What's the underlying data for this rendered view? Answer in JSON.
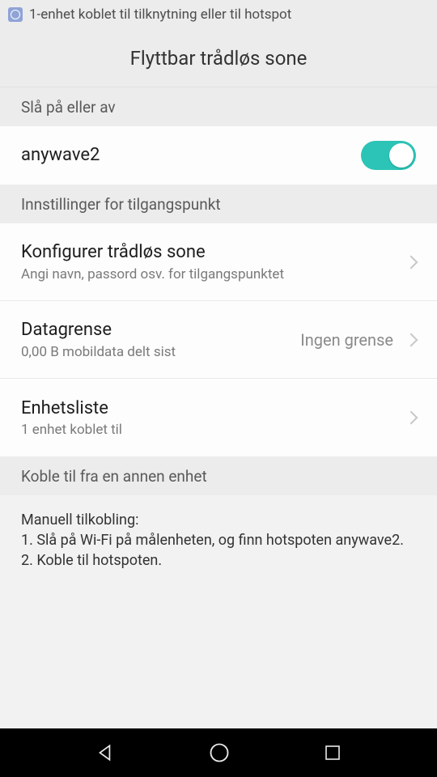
{
  "notif": {
    "text": "1-enhet koblet til tilknytning eller til hotspot"
  },
  "title": "Flyttbar trådløs sone",
  "sections": {
    "toggle_header": "Slå på eller av",
    "ap_header": "Innstillinger for tilgangspunkt",
    "connect_header": "Koble til fra en annen enhet"
  },
  "hotspot": {
    "ssid": "anywave2",
    "enabled": true
  },
  "config": {
    "title": "Konfigurer trådløs sone",
    "sub": "Angi navn, passord osv. for tilgangspunktet"
  },
  "datalimit": {
    "title": "Datagrense",
    "sub": "0,00 B mobildata delt sist",
    "value": "Ingen grense"
  },
  "devices": {
    "title": "Enhetsliste",
    "sub": "1 enhet koblet til"
  },
  "instructions": {
    "heading": "Manuell tilkobling:",
    "step1": "1. Slå på Wi-Fi på målenheten, og finn hotspoten anywave2.",
    "step2": "2. Koble til hotspoten."
  }
}
